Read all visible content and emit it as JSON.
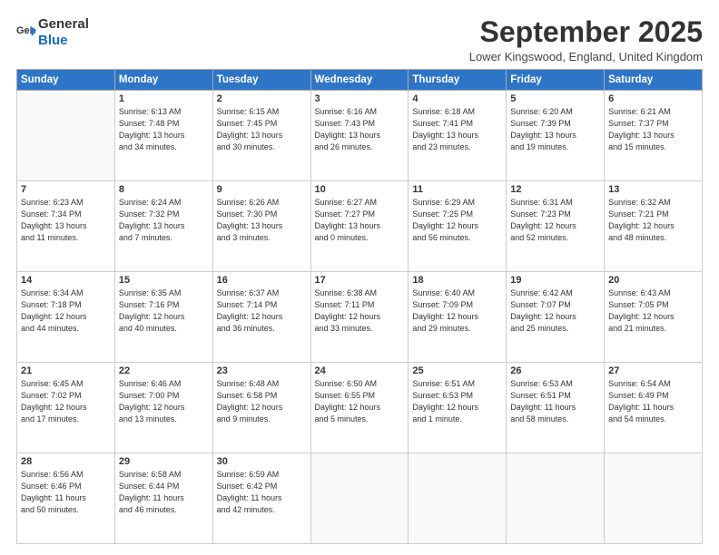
{
  "logo": {
    "general": "General",
    "blue": "Blue"
  },
  "title": "September 2025",
  "subtitle": "Lower Kingswood, England, United Kingdom",
  "weekdays": [
    "Sunday",
    "Monday",
    "Tuesday",
    "Wednesday",
    "Thursday",
    "Friday",
    "Saturday"
  ],
  "weeks": [
    [
      {
        "day": "",
        "info": ""
      },
      {
        "day": "1",
        "info": "Sunrise: 6:13 AM\nSunset: 7:48 PM\nDaylight: 13 hours\nand 34 minutes."
      },
      {
        "day": "2",
        "info": "Sunrise: 6:15 AM\nSunset: 7:45 PM\nDaylight: 13 hours\nand 30 minutes."
      },
      {
        "day": "3",
        "info": "Sunrise: 6:16 AM\nSunset: 7:43 PM\nDaylight: 13 hours\nand 26 minutes."
      },
      {
        "day": "4",
        "info": "Sunrise: 6:18 AM\nSunset: 7:41 PM\nDaylight: 13 hours\nand 23 minutes."
      },
      {
        "day": "5",
        "info": "Sunrise: 6:20 AM\nSunset: 7:39 PM\nDaylight: 13 hours\nand 19 minutes."
      },
      {
        "day": "6",
        "info": "Sunrise: 6:21 AM\nSunset: 7:37 PM\nDaylight: 13 hours\nand 15 minutes."
      }
    ],
    [
      {
        "day": "7",
        "info": "Sunrise: 6:23 AM\nSunset: 7:34 PM\nDaylight: 13 hours\nand 11 minutes."
      },
      {
        "day": "8",
        "info": "Sunrise: 6:24 AM\nSunset: 7:32 PM\nDaylight: 13 hours\nand 7 minutes."
      },
      {
        "day": "9",
        "info": "Sunrise: 6:26 AM\nSunset: 7:30 PM\nDaylight: 13 hours\nand 3 minutes."
      },
      {
        "day": "10",
        "info": "Sunrise: 6:27 AM\nSunset: 7:27 PM\nDaylight: 13 hours\nand 0 minutes."
      },
      {
        "day": "11",
        "info": "Sunrise: 6:29 AM\nSunset: 7:25 PM\nDaylight: 12 hours\nand 56 minutes."
      },
      {
        "day": "12",
        "info": "Sunrise: 6:31 AM\nSunset: 7:23 PM\nDaylight: 12 hours\nand 52 minutes."
      },
      {
        "day": "13",
        "info": "Sunrise: 6:32 AM\nSunset: 7:21 PM\nDaylight: 12 hours\nand 48 minutes."
      }
    ],
    [
      {
        "day": "14",
        "info": "Sunrise: 6:34 AM\nSunset: 7:18 PM\nDaylight: 12 hours\nand 44 minutes."
      },
      {
        "day": "15",
        "info": "Sunrise: 6:35 AM\nSunset: 7:16 PM\nDaylight: 12 hours\nand 40 minutes."
      },
      {
        "day": "16",
        "info": "Sunrise: 6:37 AM\nSunset: 7:14 PM\nDaylight: 12 hours\nand 36 minutes."
      },
      {
        "day": "17",
        "info": "Sunrise: 6:38 AM\nSunset: 7:11 PM\nDaylight: 12 hours\nand 33 minutes."
      },
      {
        "day": "18",
        "info": "Sunrise: 6:40 AM\nSunset: 7:09 PM\nDaylight: 12 hours\nand 29 minutes."
      },
      {
        "day": "19",
        "info": "Sunrise: 6:42 AM\nSunset: 7:07 PM\nDaylight: 12 hours\nand 25 minutes."
      },
      {
        "day": "20",
        "info": "Sunrise: 6:43 AM\nSunset: 7:05 PM\nDaylight: 12 hours\nand 21 minutes."
      }
    ],
    [
      {
        "day": "21",
        "info": "Sunrise: 6:45 AM\nSunset: 7:02 PM\nDaylight: 12 hours\nand 17 minutes."
      },
      {
        "day": "22",
        "info": "Sunrise: 6:46 AM\nSunset: 7:00 PM\nDaylight: 12 hours\nand 13 minutes."
      },
      {
        "day": "23",
        "info": "Sunrise: 6:48 AM\nSunset: 6:58 PM\nDaylight: 12 hours\nand 9 minutes."
      },
      {
        "day": "24",
        "info": "Sunrise: 6:50 AM\nSunset: 6:55 PM\nDaylight: 12 hours\nand 5 minutes."
      },
      {
        "day": "25",
        "info": "Sunrise: 6:51 AM\nSunset: 6:53 PM\nDaylight: 12 hours\nand 1 minute."
      },
      {
        "day": "26",
        "info": "Sunrise: 6:53 AM\nSunset: 6:51 PM\nDaylight: 11 hours\nand 58 minutes."
      },
      {
        "day": "27",
        "info": "Sunrise: 6:54 AM\nSunset: 6:49 PM\nDaylight: 11 hours\nand 54 minutes."
      }
    ],
    [
      {
        "day": "28",
        "info": "Sunrise: 6:56 AM\nSunset: 6:46 PM\nDaylight: 11 hours\nand 50 minutes."
      },
      {
        "day": "29",
        "info": "Sunrise: 6:58 AM\nSunset: 6:44 PM\nDaylight: 11 hours\nand 46 minutes."
      },
      {
        "day": "30",
        "info": "Sunrise: 6:59 AM\nSunset: 6:42 PM\nDaylight: 11 hours\nand 42 minutes."
      },
      {
        "day": "",
        "info": ""
      },
      {
        "day": "",
        "info": ""
      },
      {
        "day": "",
        "info": ""
      },
      {
        "day": "",
        "info": ""
      }
    ]
  ]
}
